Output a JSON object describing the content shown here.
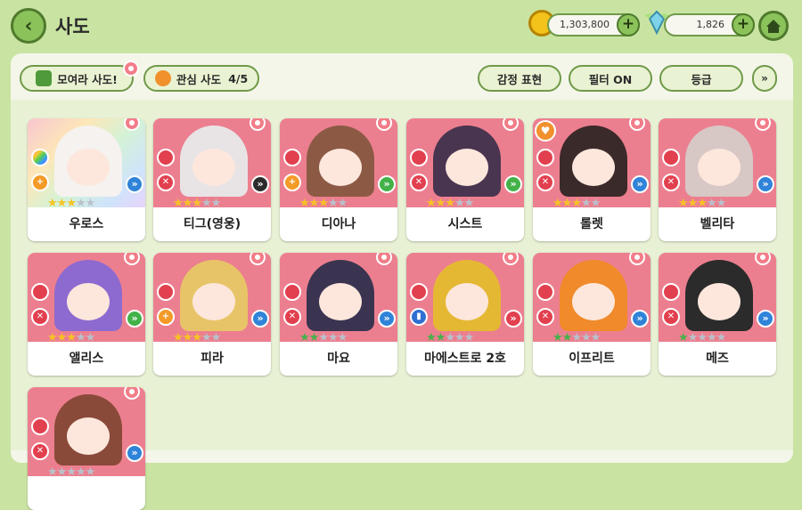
{
  "header": {
    "title": "사도",
    "coins": "1,303,800",
    "gems": "1,826"
  },
  "toolbar": {
    "collect_label": "모여라 사도!",
    "favorites_label": "관심 사도",
    "favorites_count": "4/5",
    "emotion_label": "감정 표현",
    "filter_label": "필터 ON",
    "grade_label": "등급"
  },
  "cards": [
    {
      "name": "우로스",
      "stars_total": 5,
      "stars_filled": 3,
      "star_color": "gold"
    },
    {
      "name": "티그(영웅)",
      "stars_total": 5,
      "stars_filled": 3,
      "star_color": "gold"
    },
    {
      "name": "디아나",
      "stars_total": 5,
      "stars_filled": 3,
      "star_color": "gold"
    },
    {
      "name": "시스트",
      "stars_total": 5,
      "stars_filled": 3,
      "star_color": "gold"
    },
    {
      "name": "롤렛",
      "stars_total": 5,
      "stars_filled": 3,
      "star_color": "gold",
      "favorite": true
    },
    {
      "name": "벨리타",
      "stars_total": 5,
      "stars_filled": 3,
      "star_color": "gold"
    },
    {
      "name": "앨리스",
      "stars_total": 5,
      "stars_filled": 3,
      "star_color": "gold"
    },
    {
      "name": "피라",
      "stars_total": 5,
      "stars_filled": 3,
      "star_color": "gold"
    },
    {
      "name": "마요",
      "stars_total": 5,
      "stars_filled": 2,
      "star_color": "green"
    },
    {
      "name": "마에스트로 2호",
      "stars_total": 5,
      "stars_filled": 2,
      "star_color": "green"
    },
    {
      "name": "이프리트",
      "stars_total": 5,
      "stars_filled": 2,
      "star_color": "green"
    },
    {
      "name": "메즈",
      "stars_total": 5,
      "stars_filled": 1,
      "star_color": "green"
    },
    {
      "name": "",
      "stars_total": 5,
      "stars_filled": 0,
      "star_color": "green"
    }
  ],
  "colors": {
    "background": "#c9e4a2",
    "card_pink": "#ec7f8f",
    "accent_green": "#8bc35a",
    "gold_star": "#f6c324",
    "green_star": "#46b14a"
  },
  "icons": [
    "back-arrow-icon",
    "coin-icon",
    "gem-icon",
    "plus-icon",
    "home-icon",
    "flower-icon",
    "fire-icon",
    "heart-icon",
    "chevron-double-down-icon"
  ]
}
